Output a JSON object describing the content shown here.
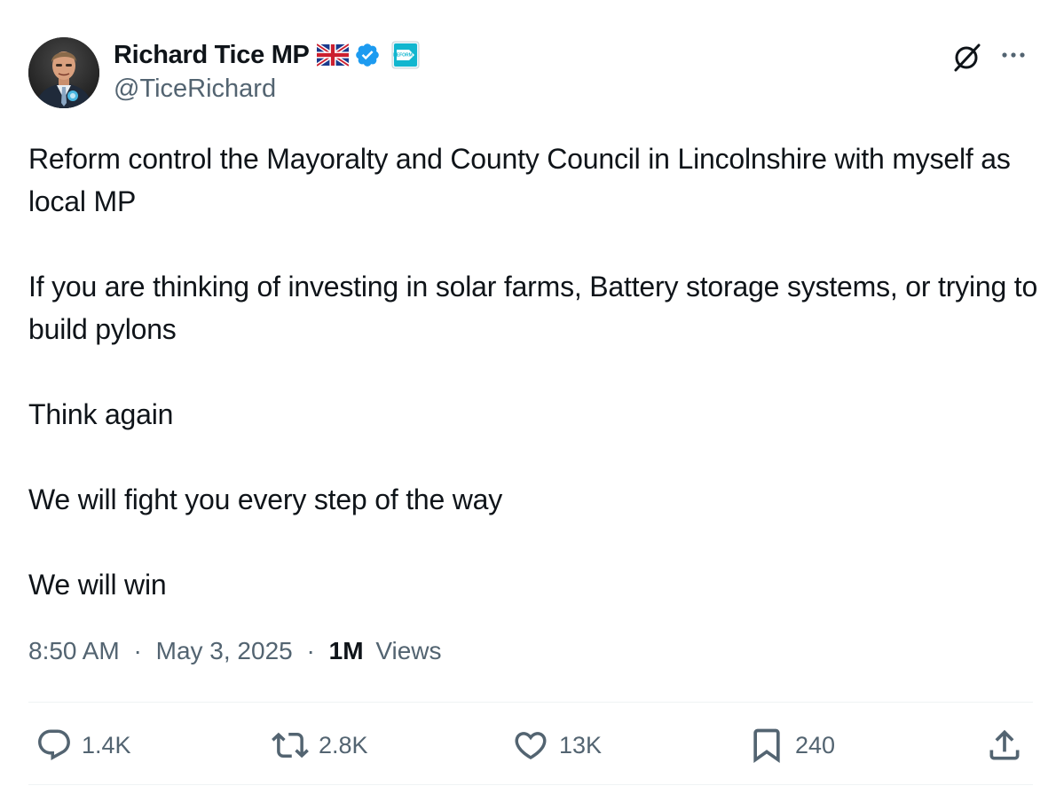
{
  "author": {
    "name": "Richard Tice MP",
    "handle": "@TiceRichard",
    "flag_icon": "union-jack-flag-icon",
    "verified_icon": "verified-badge-icon",
    "affiliate_icon": "reform-uk-affiliate-icon",
    "affiliate_text": "REFORM"
  },
  "tweet": {
    "paragraphs": [
      "Reform control the Mayoralty and County Council in Lincolnshire with myself as local MP",
      "If you are thinking of investing in solar farms, Battery storage systems, or trying to build pylons",
      "Think again",
      "We will fight you every step of the way",
      "We will win"
    ],
    "time": "8:50 AM",
    "separator": "·",
    "date": "May 3, 2025",
    "views_count": "1M",
    "views_label": "Views"
  },
  "actions": {
    "reply_count": "1.4K",
    "repost_count": "2.8K",
    "like_count": "13K",
    "bookmark_count": "240"
  },
  "colors": {
    "text": "#0f1419",
    "secondary": "#536471",
    "verified": "#1d9bf0",
    "divider": "#eff3f4"
  }
}
